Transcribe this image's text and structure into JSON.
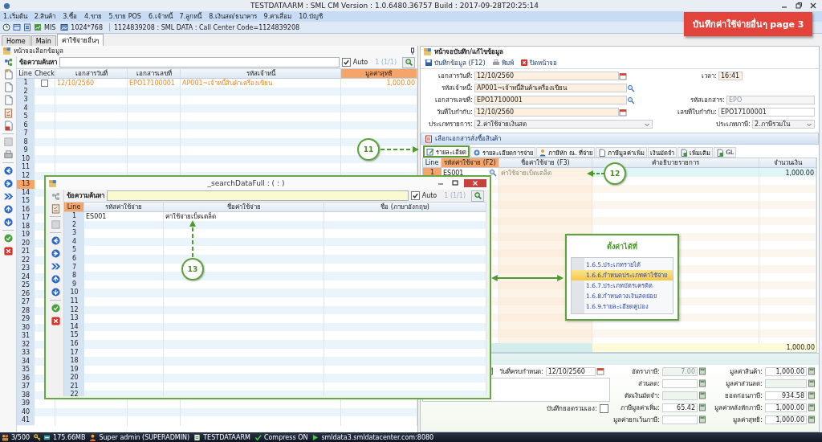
{
  "window": {
    "title": "TESTDATAARM : SML CM Version : 1.0.6480.36757  Build : 2017-09-28T20:25:14"
  },
  "menu": [
    "1.เริ่มต้น",
    "2.สินค้า",
    "3.ซื้อ",
    "4.ขาย",
    "5.ขาย POS",
    "6.เจ้าหนี้",
    "7.ลูกหนี้",
    "8.เงินสด/ธนาคาร",
    "9.ค่าเสื่อม",
    "10.บัญชี"
  ],
  "toolbar": {
    "mode": "MIS",
    "resolution": "1024*768",
    "info": "1124839208 : SML DATA : Call Center Code=1124839208"
  },
  "banner": "บันทึกค่าใช้จ่ายอื่นๆ page 3",
  "tabs": [
    {
      "label": "Home",
      "selected": false
    },
    {
      "label": "Main",
      "selected": false
    },
    {
      "label": "ค่าใช้จ่ายอื่นๆ",
      "selected": true
    }
  ],
  "list_panel": {
    "title": "หน้าจอเลือกข้อมูล",
    "search_label": "ข้อความค้นหา",
    "auto_checked": true,
    "auto_label": "Auto",
    "page": "1 (1/1)",
    "columns": [
      {
        "label": "Line",
        "highlighted": false
      },
      {
        "label": "Check",
        "highlighted": false
      },
      {
        "label": "เอกสารวันที่",
        "highlighted": false
      },
      {
        "label": "เอกสารเลขที่",
        "highlighted": false
      },
      {
        "label": "รหัสเจ้าหนี้",
        "highlighted": false
      },
      {
        "label": "มูลค่าสุทธิ",
        "highlighted": true
      }
    ],
    "rows": [
      {
        "line": "1",
        "selected": false,
        "checked": false,
        "cells": [
          "12/10/2560",
          "EPO17100001",
          "AP001~เจ้าหนี้สินค้าเครื่องเขียน",
          "1,000.00"
        ]
      },
      {
        "line": "2",
        "selected": false
      },
      {
        "line": "3",
        "selected": false
      },
      {
        "line": "4",
        "selected": false
      },
      {
        "line": "5",
        "selected": false
      },
      {
        "line": "6",
        "selected": false
      },
      {
        "line": "7",
        "selected": false
      },
      {
        "line": "8",
        "selected": false
      },
      {
        "line": "9",
        "selected": false
      },
      {
        "line": "10",
        "selected": false
      },
      {
        "line": "11",
        "selected": false
      },
      {
        "line": "12",
        "selected": false
      },
      {
        "line": "13",
        "selected": true
      },
      {
        "line": "14",
        "selected": false
      },
      {
        "line": "15",
        "selected": false
      },
      {
        "line": "16",
        "selected": false
      },
      {
        "line": "17",
        "selected": false
      },
      {
        "line": "18",
        "selected": false
      },
      {
        "line": "19",
        "selected": false
      },
      {
        "line": "20",
        "selected": false
      },
      {
        "line": "21",
        "selected": false
      },
      {
        "line": "22",
        "selected": false
      },
      {
        "line": "23",
        "selected": false
      },
      {
        "line": "24",
        "selected": false
      },
      {
        "line": "25",
        "selected": false
      },
      {
        "line": "26",
        "selected": false
      },
      {
        "line": "27",
        "selected": false
      },
      {
        "line": "28",
        "selected": false
      },
      {
        "line": "29",
        "selected": false
      },
      {
        "line": "30",
        "selected": false
      },
      {
        "line": "31",
        "selected": false
      },
      {
        "line": "32",
        "selected": false
      },
      {
        "line": "33",
        "selected": false
      },
      {
        "line": "34",
        "selected": false
      },
      {
        "line": "35",
        "selected": false
      },
      {
        "line": "36",
        "selected": false
      },
      {
        "line": "37",
        "selected": false
      },
      {
        "line": "38",
        "selected": false
      },
      {
        "line": "39",
        "selected": false
      },
      {
        "line": "40",
        "selected": false
      },
      {
        "line": "41",
        "selected": false
      }
    ]
  },
  "edit_panel": {
    "title": "หน้าจอบันทึก/แก้ไขข้อมูล",
    "actions": [
      {
        "kind": "save",
        "label": "บันทึกข้อมูล (F12)"
      },
      {
        "kind": "print",
        "label": "พิมพ์"
      },
      {
        "kind": "close",
        "label": "ปิดหน้าจอ"
      }
    ],
    "form": [
      {
        "left": {
          "label": "เอกสารวันที่:",
          "value": "12/10/2560",
          "kind": "date"
        },
        "right": {
          "label": "เวลา:",
          "value": "16:41",
          "kind": "time"
        }
      },
      {
        "left": {
          "label": "รหัสเจ้าหนี้:",
          "value": "AP001~เจ้าหนี้สินค้าเครื่องเขียน",
          "kind": "lookup"
        }
      },
      {
        "left": {
          "label": "เอกสารเลขที่:",
          "value": "EPO17100001",
          "kind": "lookup"
        },
        "right": {
          "label": "รหัสเอกสาร:",
          "value": "EPO",
          "kind": "readonly"
        }
      },
      {
        "left": {
          "label": "วันที่ใบกำกับ:",
          "value": "12/10/2560",
          "kind": "date"
        },
        "right": {
          "label": "เลขที่ใบกำกับ:",
          "value": "EPO17100001",
          "kind": "text"
        }
      },
      {
        "left": {
          "label": "ประเภทรายการ:",
          "value": "2.ค่าใช้จ่ายเงินสด",
          "kind": "select"
        },
        "right": {
          "label": "ประเภทภาษี:",
          "value": "2.ภาษีรวมใน",
          "kind": "select"
        }
      }
    ],
    "order_bar": "เลือกเอกสารสั่งซื้อสินค้า",
    "tabs": [
      {
        "label": "รายละเอียด",
        "selected": true,
        "kind": "detail"
      },
      {
        "label": "รายละเอียดการจ่าย",
        "selected": false,
        "kind": "payment"
      },
      {
        "label": "ภาษีหัก ณ. ที่จ่าย",
        "selected": false,
        "kind": "withholding"
      },
      {
        "label": "ภาษีมูลค่าเพิ่ม",
        "selected": false,
        "kind": "vat"
      },
      {
        "label": "เงินมัดจำ",
        "selected": false,
        "kind": "deposit"
      },
      {
        "label": "เพิ่มเติม",
        "selected": false,
        "kind": "more"
      },
      {
        "label": "GL",
        "selected": false,
        "kind": "gl"
      }
    ],
    "columns": [
      {
        "label": "Line",
        "highlighted": false
      },
      {
        "label": "รหัสค่าใช้จ่าย (F2)",
        "highlighted": true
      },
      {
        "label": "ชื่อค่าใช้จ่าย (F3)",
        "highlighted": false
      },
      {
        "label": "คำอธิบายรายการ",
        "highlighted": false
      },
      {
        "label": "จำนวนเงิน",
        "highlighted": false
      }
    ],
    "rows": [
      {
        "line": "1",
        "code": "ES001",
        "name": "ค่าใช้จ่ายเบ็ดเตล็ด",
        "amount": "1,000.00"
      }
    ],
    "total": "1,000.00",
    "due_date": {
      "label": "วันที่ครบกำหนด:",
      "value": "12/10/2560"
    },
    "manual_total": {
      "label": "บันทึกยอดรวมเอง:",
      "checked": false
    },
    "tax_fields": [
      {
        "label": "อัตราภาษี:",
        "value": "7.00",
        "kind": "readonly"
      },
      {
        "label": "ส่วนลด:",
        "kind": "input"
      },
      {
        "label": "ตัดเงินมัดจำ:",
        "kind": "readonly"
      },
      {
        "label": "ภาษีมูลค่าเพิ่ม:",
        "value": "65.42",
        "kind": "input"
      },
      {
        "label": "มูลค่ายกเว้นภาษี:",
        "kind": "input"
      }
    ],
    "total_fields": [
      {
        "label": "มูลค่าสินค้า:",
        "value": "1,000.00",
        "kind": "input"
      },
      {
        "label": "มูลค่าส่วนลด:",
        "kind": "readonly"
      },
      {
        "label": "ยอดก่อนภาษี:",
        "value": "934.58",
        "kind": "input"
      },
      {
        "label": "มูลค่าหลังหักภาษี:",
        "value": "1,000.00",
        "kind": "input"
      },
      {
        "label": "มูลค่าสุทธิ:",
        "value": "1,000.00",
        "kind": "input"
      }
    ]
  },
  "dialog": {
    "title": "_searchDataFull : ( : )",
    "search_label": "ข้อความค้นหา",
    "auto_checked": true,
    "auto_label": "Auto",
    "page": "1 (1/1)",
    "columns": [
      {
        "label": "Line",
        "highlighted": true
      },
      {
        "label": "รหัสค่าใช้จ่าย",
        "highlighted": false
      },
      {
        "label": "ชื่อค่าใช้จ่าย",
        "highlighted": false
      },
      {
        "label": "ชื่อ (ภาษาอังกฤษ)",
        "highlighted": false
      }
    ],
    "rows": [
      {
        "line": "1",
        "cells": [
          "ES001",
          "ค่าใช้จ่ายเบ็ดเตล็ด"
        ]
      },
      {
        "line": "2"
      },
      {
        "line": "3"
      },
      {
        "line": "4"
      },
      {
        "line": "5"
      },
      {
        "line": "6"
      },
      {
        "line": "7"
      },
      {
        "line": "8"
      },
      {
        "line": "9"
      },
      {
        "line": "10"
      },
      {
        "line": "11"
      },
      {
        "line": "12"
      },
      {
        "line": "13"
      },
      {
        "line": "14"
      },
      {
        "line": "15"
      },
      {
        "line": "16"
      },
      {
        "line": "17"
      },
      {
        "line": "18"
      },
      {
        "line": "19"
      },
      {
        "line": "20"
      },
      {
        "line": "21"
      },
      {
        "line": "22"
      }
    ]
  },
  "callouts": [
    {
      "number": "11"
    },
    {
      "number": "12"
    },
    {
      "number": "13"
    }
  ],
  "settings_note": {
    "title": "ตั้งค่าได้ที่",
    "items": [
      {
        "label": "1.6.5.ประเภทรายได้",
        "selected": false
      },
      {
        "label": "1.6.6.กำหนดประเภทค่าใช้จ่าย",
        "selected": true
      },
      {
        "label": "1.6.7.ประเภทบัตรเครดิต",
        "selected": false
      },
      {
        "label": "1.6.8.กำหนดวงเงินสดย่อย",
        "selected": false
      },
      {
        "label": "1.6.9.รายละเอียดคูปอง",
        "selected": false
      }
    ]
  },
  "status_bar": [
    {
      "kind": "users",
      "text": "3/500"
    },
    {
      "kind": "memory",
      "text": "175.66MB"
    },
    {
      "kind": "user",
      "text": "Super admin (SUPERADMIN)"
    },
    {
      "kind": "database",
      "text": "TESTDATAARM"
    },
    {
      "kind": "compress",
      "text": "Compress ON"
    },
    {
      "kind": "server",
      "text": "smldata3.smldatacenter.com:8080"
    }
  ]
}
